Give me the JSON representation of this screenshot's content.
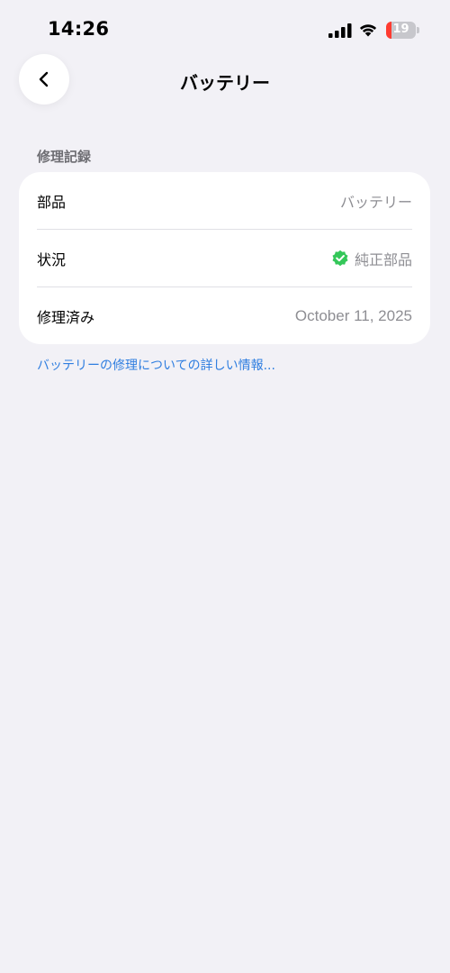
{
  "status_bar": {
    "time": "14:26",
    "battery_level": "19",
    "battery_fraction": 0.19,
    "battery_color": "#ff3b30",
    "icons": [
      "cellular-signal-icon",
      "wifi-icon",
      "battery-icon"
    ]
  },
  "nav": {
    "back_icon": "chevron-left-icon",
    "title": "バッテリー"
  },
  "section": {
    "header": "修理記録",
    "rows": [
      {
        "label": "部品",
        "value": "バッテリー"
      },
      {
        "label": "状況",
        "value": "純正部品",
        "icon": "verified-check-badge-icon",
        "icon_color": "#34c759"
      },
      {
        "label": "修理済み",
        "value": "October 11, 2025"
      }
    ]
  },
  "link": {
    "text": "バッテリーの修理についての詳しい情報...",
    "color": "#2f7ee0"
  }
}
